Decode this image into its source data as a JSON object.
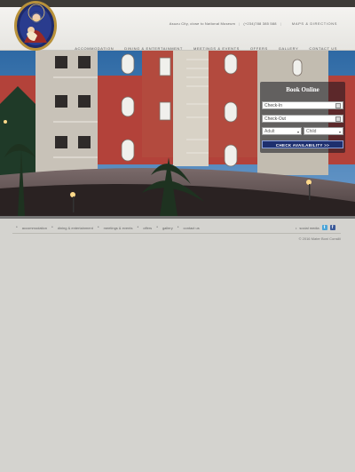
{
  "header": {
    "address": "Asuzu City, close to National Museum",
    "phone": "(+234)788 385 588",
    "maps": "MAPS & DIRECTIONS"
  },
  "nav": [
    "ACCOMMODATION",
    "DINING & ENTERTAINMENT",
    "MEETINGS & EVENTS",
    "OFFERS",
    "GALLERY",
    "CONTACT US"
  ],
  "booking": {
    "title": "Book Online",
    "checkin": "Check-In",
    "checkout": "Check-Out",
    "adult": "Adult",
    "child": "Child",
    "button": "CHECK AVAILABILITY >>"
  },
  "footer": {
    "links": [
      "accommodation",
      "dining & entertainment",
      "meetings & events",
      "offers",
      "gallery",
      "contact us"
    ],
    "social_label": "social media",
    "copyright": "© 2016 Mater Boni Consilii"
  }
}
